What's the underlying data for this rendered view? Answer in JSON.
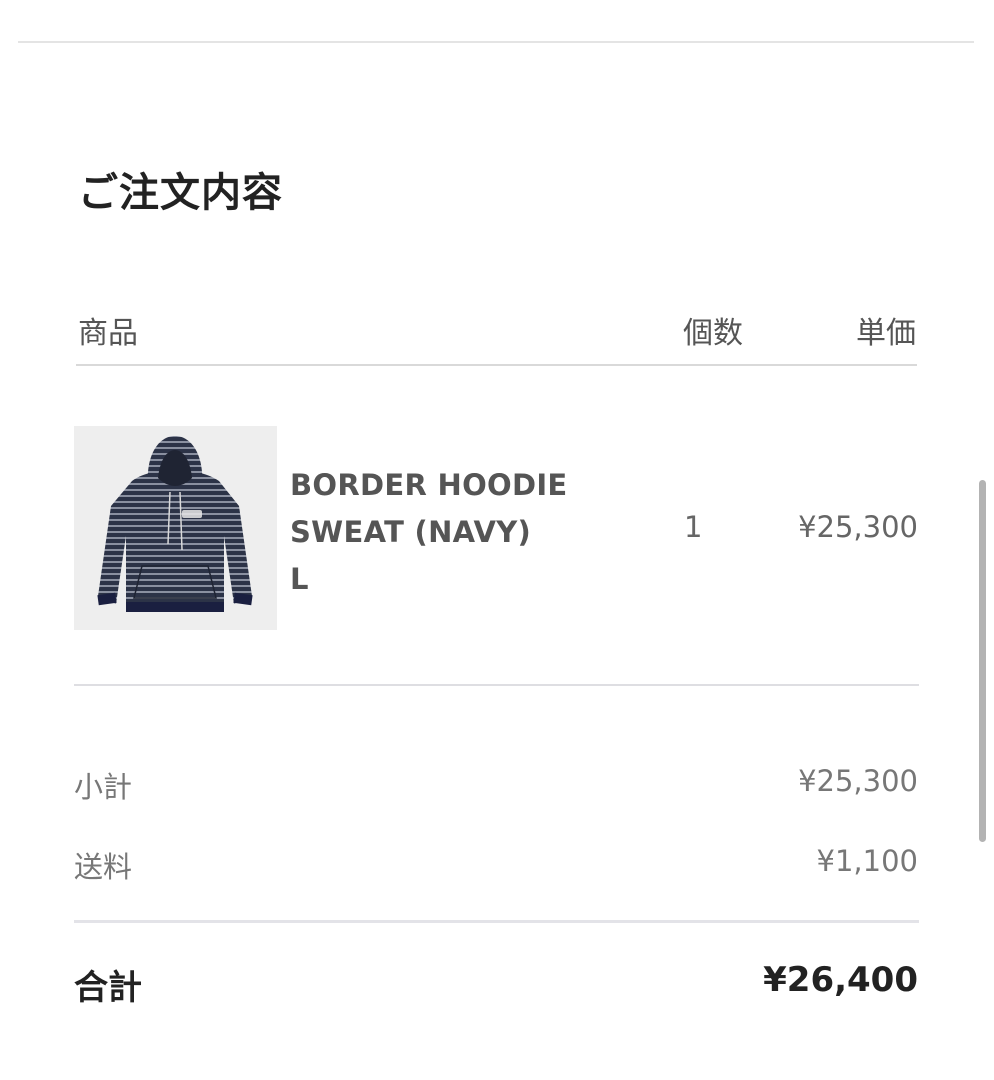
{
  "order_summary": {
    "title": "ご注文内容",
    "columns": {
      "product": "商品",
      "quantity": "個数",
      "unit_price": "単価"
    },
    "items": [
      {
        "name_lines": [
          "BORDER HOODIE",
          "SWEAT (NAVY)",
          "L"
        ],
        "quantity": "1",
        "price": "¥25,300",
        "image_icon": "hoodie-product-image"
      }
    ],
    "subtotal": {
      "label": "小計",
      "value": "¥25,300"
    },
    "shipping": {
      "label": "送料",
      "value": "¥1,100"
    },
    "total": {
      "label": "合計",
      "value": "¥26,400"
    }
  },
  "colors": {
    "hoodie_navy": "#2c3347",
    "hoodie_stripe": "#8a90a0",
    "heading_text": "#222222",
    "muted_text": "#777777"
  }
}
